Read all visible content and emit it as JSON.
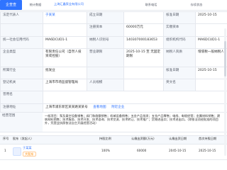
{
  "header": {
    "badge": "企查查",
    "company_search": "上海汇鑫泵业有限公司",
    "tab_stats": "统计数据",
    "tab_contact": "联系电话",
    "tab_status": "存续状态",
    "tab_title": "法定代表人"
  },
  "rows": [
    {
      "label": "法定代表人",
      "value": "于某某",
      "value_class": "blue",
      "mid_label": "成立日期",
      "mid_value": "",
      "right_label": "核准日期",
      "right_value": "2025-10-15"
    },
    {
      "label": "",
      "value": "",
      "mid_label": "注册资本",
      "mid_value": "60000万元",
      "right_label": "实缴资本",
      "right_value": ""
    },
    {
      "label": "统一社会信用代码",
      "value": "MA6DCUD1-1",
      "mid_label": "纳税人识别号",
      "mid_value": "140307000183653",
      "right_label": "组织机构代码",
      "right_value": "MA6DCUD1-1"
    },
    {
      "label": "企业类型",
      "value": "有限责任公司（自然人投资或控股）",
      "mid_label": "营业期限",
      "mid_value": "2025-10-15 至 无固定期限",
      "right_label": "纳税人资质",
      "right_value": "增值税一般纳税人"
    },
    {
      "label": "所属行业",
      "value": "批发业",
      "mid_label": "",
      "mid_value": "",
      "right_label": "核准日期",
      "right_value": "2025-10-15"
    },
    {
      "label": "登记机关",
      "value": "上海市市场监督管理局",
      "mid_label": "人员规模",
      "mid_value": "",
      "right_label": "英文名",
      "right_value": ""
    },
    {
      "label": "曾用名",
      "value": "",
      "mid_label": "",
      "mid_value": "",
      "right_label": "",
      "right_value": ""
    }
  ],
  "address": {
    "label": "注册地址",
    "value": "上海市浦东新区某某路某某号",
    "map_link": "查看地图",
    "nearby_link": "附近企业"
  },
  "scope": {
    "label": "经营范围",
    "text": "一般项目：泵及真空设备销售；阀门和旋塞销售；机械设备销售；五金产品批发；五金产品零售；电线、电缆经营；金属材料销售；建筑材料销售；技术服务、技术开发、技术咨询、技术交流、技术转让、技术推广；货物进出口；技术进出口。（除依法须经批准的项目外，凭营业执照依法自主开展经营活动）"
  },
  "shareholders": {
    "headers": [
      "序号",
      "股东（发起人）",
      "持股比例",
      "认缴出资额(万元)",
      "认缴出资日期",
      "首次持股日期"
    ],
    "rows": [
      {
        "index": "1",
        "name": "于某某",
        "tag": "大股东",
        "ratio": "100%",
        "amount": "60000",
        "date": "2045-10-15",
        "first": "2025-10-15"
      }
    ]
  }
}
